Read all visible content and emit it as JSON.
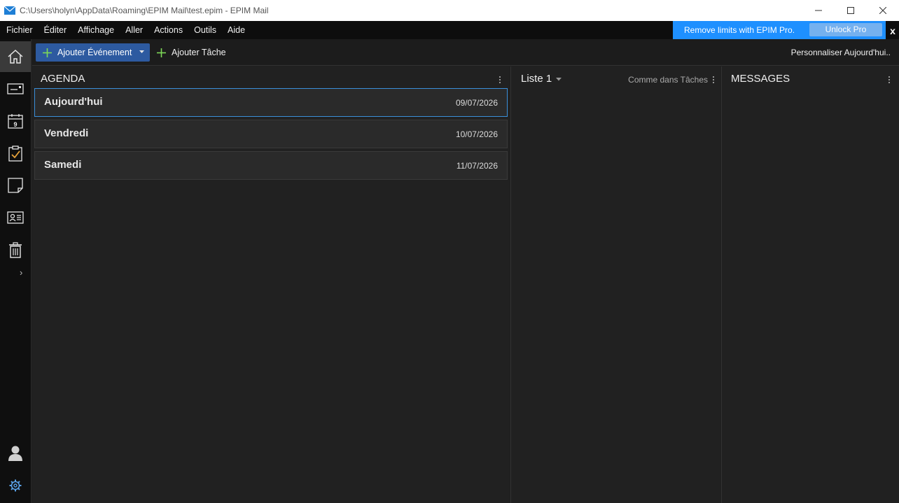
{
  "window": {
    "title": "C:\\Users\\holyn\\AppData\\Roaming\\EPIM Mail\\test.epim - EPIM Mail"
  },
  "menu": [
    "Fichier",
    "Éditer",
    "Affichage",
    "Aller",
    "Actions",
    "Outils",
    "Aide"
  ],
  "promo": {
    "text": "Remove limits with EPIM Pro.",
    "button": "Unlock Pro",
    "close": "x"
  },
  "sidebar": {
    "items": [
      "home-icon",
      "mail-icon",
      "calendar-icon",
      "tasks-icon",
      "notes-icon",
      "contacts-icon",
      "trash-icon"
    ],
    "calendar_day": "9",
    "expand": "›"
  },
  "toolbar": {
    "add_event": "Ajouter Événement",
    "add_task": "Ajouter Tâche",
    "customize": "Personnaliser Aujourd'hui.."
  },
  "agenda": {
    "title": "AGENDA",
    "days": [
      {
        "name": "Aujourd'hui",
        "date": "09/07/2026"
      },
      {
        "name": "Vendredi",
        "date": "10/07/2026"
      },
      {
        "name": "Samedi",
        "date": "11/07/2026"
      }
    ]
  },
  "liste": {
    "title": "Liste 1",
    "sort": "Comme dans Tâches"
  },
  "messages": {
    "title": "MESSAGES"
  },
  "colors": {
    "accent": "#1e90ff",
    "button_primary": "#2d5aa0",
    "selection_border": "#3a8fd9",
    "plus_green": "#7ed957"
  }
}
